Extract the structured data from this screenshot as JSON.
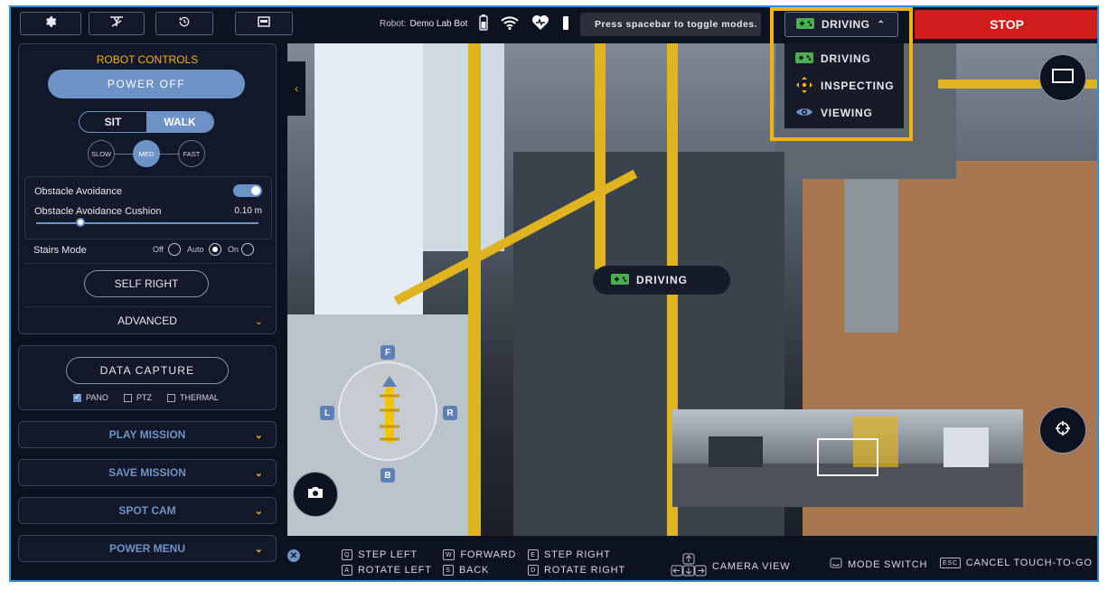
{
  "topbar": {
    "robot_label": "Robot:",
    "robot_name": "Demo Lab Bot",
    "toast": "Press spacebar to toggle modes.",
    "mode_selected": "DRIVING",
    "stop_label": "STOP"
  },
  "mode_menu": {
    "items": [
      {
        "label": "DRIVING",
        "icon": "gamepad-icon",
        "color": "#4caf50"
      },
      {
        "label": "INSPECTING",
        "icon": "inspect-cross-icon",
        "color": "#f2b40b"
      },
      {
        "label": "VIEWING",
        "icon": "eye-icon",
        "color": "#6d93c6"
      }
    ]
  },
  "robot_controls": {
    "title": "ROBOT CONTROLS",
    "power_off": "POWER OFF",
    "sit": "SIT",
    "walk": "WALK",
    "selected_gait": "WALK",
    "speeds": [
      "SLOW",
      "MED",
      "FAST"
    ],
    "selected_speed": "MED",
    "obstacle_avoidance": "Obstacle Avoidance",
    "obstacle_avoidance_on": true,
    "cushion_label": "Obstacle Avoidance Cushion",
    "cushion_value": "0.10 m",
    "stairs_mode": "Stairs Mode",
    "stairs_options": [
      "Off",
      "Auto",
      "On"
    ],
    "stairs_selected": "Auto",
    "self_right": "SELF RIGHT",
    "advanced": "ADVANCED"
  },
  "data_capture": {
    "button": "DATA CAPTURE",
    "options": [
      {
        "label": "PANO",
        "checked": true
      },
      {
        "label": "PTZ",
        "checked": false
      },
      {
        "label": "THERMAL",
        "checked": false
      }
    ]
  },
  "menus": [
    "PLAY MISSION",
    "SAVE MISSION",
    "SPOT CAM",
    "POWER MENU"
  ],
  "camera": {
    "mode_pill": "DRIVING",
    "compass": {
      "front": "F",
      "back": "B",
      "left": "L",
      "right": "R"
    }
  },
  "hints": {
    "step_left": {
      "key": "Q",
      "label": "STEP LEFT"
    },
    "rotate_left": {
      "key": "A",
      "label": "ROTATE LEFT"
    },
    "forward": {
      "key": "W",
      "label": "FORWARD"
    },
    "back": {
      "key": "S",
      "label": "BACK"
    },
    "step_right": {
      "key": "E",
      "label": "STEP RIGHT"
    },
    "rotate_right": {
      "key": "D",
      "label": "ROTATE RIGHT"
    },
    "camera_view": {
      "label": "CAMERA VIEW"
    },
    "mode_switch": {
      "label": "MODE SWITCH"
    },
    "cancel": {
      "key": "ESC",
      "label": "CANCEL TOUCH-TO-GO"
    }
  },
  "colors": {
    "accent_blue": "#6d93c6",
    "accent_yellow": "#f2b40b",
    "stop_red": "#d21d1d",
    "frame_blue": "#2a8fd6"
  }
}
